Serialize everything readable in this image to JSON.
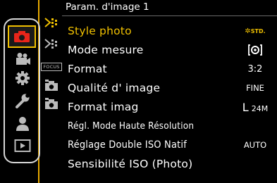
{
  "header": {
    "title": "Param. d'image 1"
  },
  "menu": {
    "items": [
      {
        "label": "Style photo",
        "value": "STD."
      },
      {
        "label": "Mode mesure",
        "value": ""
      },
      {
        "label": "Format",
        "value": "3:2"
      },
      {
        "label": "Qualité d' image",
        "value": "FINE"
      },
      {
        "label": "Format imag",
        "value_main": "L",
        "value_sub": "24M"
      },
      {
        "label": "Régl. Mode Haute Résolution",
        "value": ""
      },
      {
        "label": "Réglage Double ISO Natif",
        "value": "AUTO"
      },
      {
        "label": "Sensibilité ISO (Photo)",
        "value": ""
      }
    ]
  },
  "subtabs": {
    "focus_label": "FOCUS"
  },
  "colors": {
    "accent": "#f0c000",
    "camera_red": "#e8251a",
    "divider": "#e6a800"
  }
}
